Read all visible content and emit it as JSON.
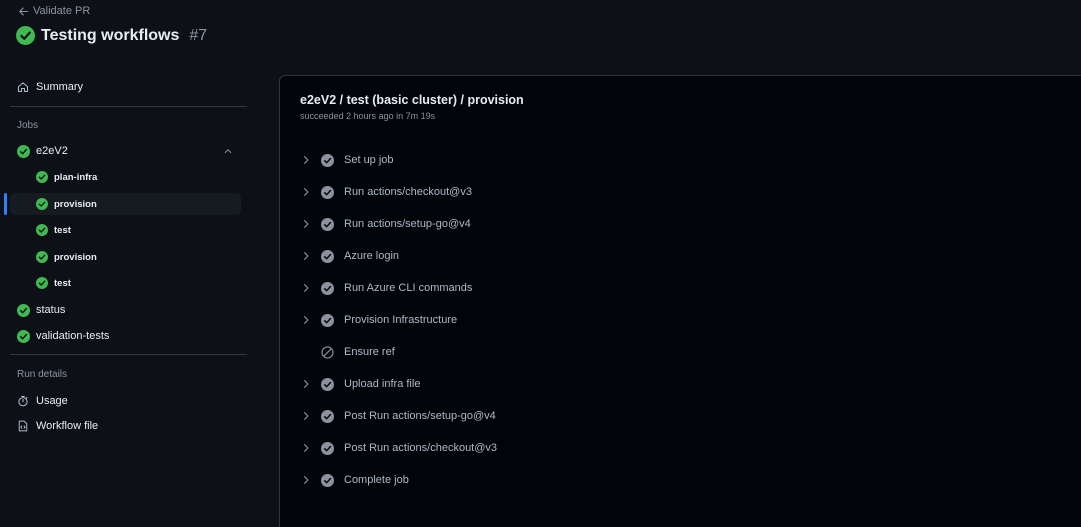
{
  "header": {
    "back_label": "Validate PR",
    "title": "Testing workflows",
    "run_number": "#7"
  },
  "sidebar": {
    "summary_label": "Summary",
    "jobs_heading": "Jobs",
    "jobs": [
      {
        "label": "e2eV2",
        "level": 0,
        "expanded": true
      },
      {
        "label": "plan-infra",
        "level": 1
      },
      {
        "label": "provision",
        "level": 1,
        "selected": true
      },
      {
        "label": "test",
        "level": 1
      },
      {
        "label": "provision",
        "level": 1
      },
      {
        "label": "test",
        "level": 1
      },
      {
        "label": "status",
        "level": 0
      },
      {
        "label": "validation-tests",
        "level": 0
      }
    ],
    "run_details_heading": "Run details",
    "usage_label": "Usage",
    "workflow_file_label": "Workflow file"
  },
  "main": {
    "title": "e2eV2 / test (basic cluster) / provision",
    "subtitle": "succeeded 2 hours ago in 7m 19s",
    "steps": [
      {
        "label": "Set up job",
        "status": "success",
        "expandable": true
      },
      {
        "label": "Run actions/checkout@v3",
        "status": "success",
        "expandable": true
      },
      {
        "label": "Run actions/setup-go@v4",
        "status": "success",
        "expandable": true
      },
      {
        "label": "Azure login",
        "status": "success",
        "expandable": true
      },
      {
        "label": "Run Azure CLI commands",
        "status": "success",
        "expandable": true
      },
      {
        "label": "Provision Infrastructure",
        "status": "success",
        "expandable": true
      },
      {
        "label": "Ensure ref",
        "status": "skipped",
        "expandable": false
      },
      {
        "label": "Upload infra file",
        "status": "success",
        "expandable": true
      },
      {
        "label": "Post Run actions/setup-go@v4",
        "status": "success",
        "expandable": true
      },
      {
        "label": "Post Run actions/checkout@v3",
        "status": "success",
        "expandable": true
      },
      {
        "label": "Complete job",
        "status": "success",
        "expandable": true
      }
    ]
  },
  "colors": {
    "success": "#3fb950",
    "step_icon": "#8b949e",
    "accent": "#2f81f7",
    "background": "#0d1117",
    "panel": "#010409"
  }
}
